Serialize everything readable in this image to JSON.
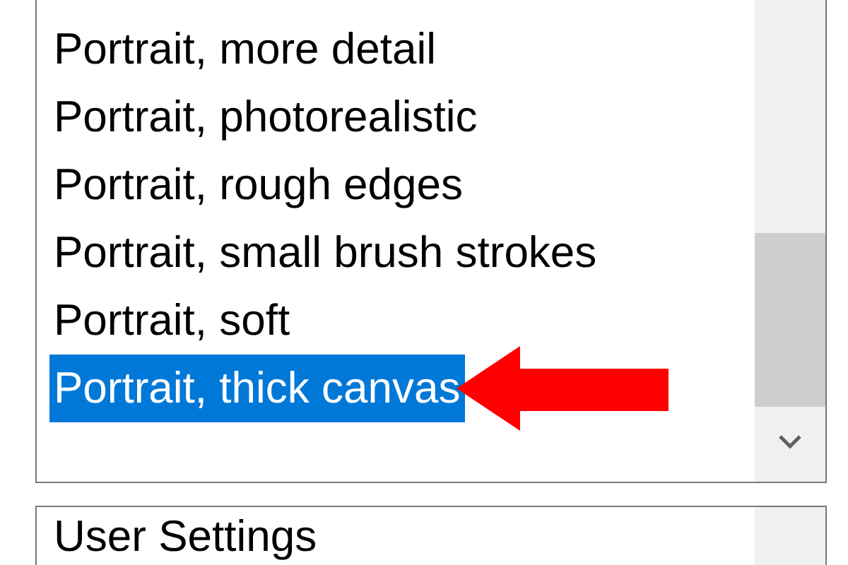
{
  "style_list": {
    "items": [
      {
        "label": "Portrait, more detail",
        "selected": false
      },
      {
        "label": "Portrait, photorealistic",
        "selected": false
      },
      {
        "label": "Portrait, rough edges",
        "selected": false
      },
      {
        "label": "Portrait, small brush strokes",
        "selected": false
      },
      {
        "label": "Portrait, soft",
        "selected": false
      },
      {
        "label": "Portrait, thick canvas",
        "selected": true
      }
    ]
  },
  "settings_list": {
    "items": [
      {
        "label": "User Settings",
        "selected": false
      }
    ]
  }
}
